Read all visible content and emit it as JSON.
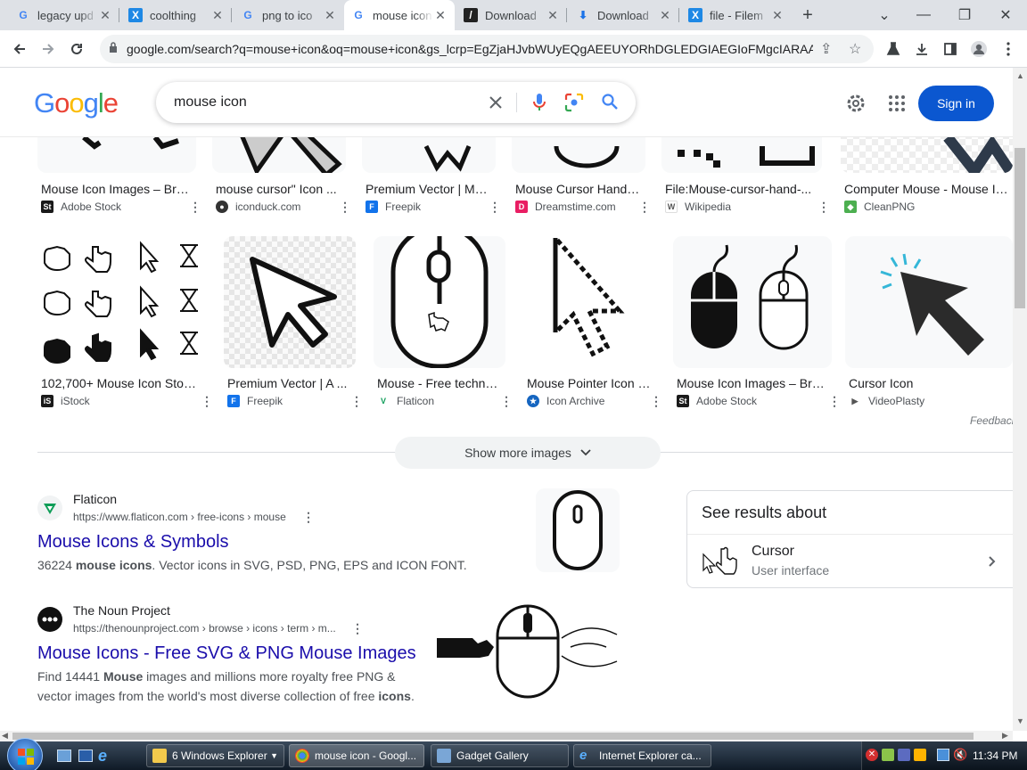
{
  "tabs": [
    {
      "title": "legacy upd",
      "fav": "G",
      "favcolor": "#4285f4"
    },
    {
      "title": "coolthing",
      "fav": "X",
      "favcolor": "#1e88e5"
    },
    {
      "title": "png to ico",
      "fav": "G",
      "favcolor": "#4285f4"
    },
    {
      "title": "mouse icon",
      "fav": "G",
      "favcolor": "#4285f4"
    },
    {
      "title": "Download",
      "fav": "/",
      "favcolor": "#333"
    },
    {
      "title": "Download",
      "fav": "⬇",
      "favcolor": "#1a73e8"
    },
    {
      "title": "file - Filem",
      "fav": "X",
      "favcolor": "#1e88e5"
    }
  ],
  "window": {
    "new_tab": "+",
    "minimize": "—",
    "maximize": "❐",
    "close": "✕",
    "tab_list": "⌄"
  },
  "omnibox": {
    "url": "google.com/search?q=mouse+icon&oq=mouse+icon&gs_lcrp=EgZjaHJvbWUyEQgAEEUYORhDGLEDGIAEGIoFMgcIARAAG..."
  },
  "search": {
    "query": "mouse icon",
    "signin": "Sign in"
  },
  "row1": [
    {
      "caption": "Mouse Icon Images – Bro...",
      "source": "Adobe Stock",
      "fav": "St",
      "favcolor": "#1a1a1a"
    },
    {
      "caption": "mouse cursor\" Icon ...",
      "source": "iconduck.com",
      "fav": "●",
      "favcolor": "#333"
    },
    {
      "caption": "Premium Vector | Mo...",
      "source": "Freepik",
      "fav": "F",
      "favcolor": "#1273eb"
    },
    {
      "caption": "Mouse Cursor Hand I...",
      "source": "Dreamstime.com",
      "fav": "D",
      "favcolor": "#e91e63"
    },
    {
      "caption": "File:Mouse-cursor-hand-...",
      "source": "Wikipedia",
      "fav": "W",
      "favcolor": "#999"
    },
    {
      "caption": "Computer Mouse - Mouse Ic...",
      "source": "CleanPNG",
      "fav": "◆",
      "favcolor": "#4caf50"
    }
  ],
  "row2": [
    {
      "caption": "102,700+ Mouse Icon Stock...",
      "source": "iStock",
      "fav": "iS",
      "favcolor": "#1a1a1a"
    },
    {
      "caption": "Premium Vector | A ...",
      "source": "Freepik",
      "fav": "F",
      "favcolor": "#1273eb"
    },
    {
      "caption": "Mouse - Free techno...",
      "source": "Flaticon",
      "fav": "V",
      "favcolor": "#0f9d58"
    },
    {
      "caption": "Mouse Pointer Icon | ...",
      "source": "Icon Archive",
      "fav": "★",
      "favcolor": "#1565c0"
    },
    {
      "caption": "Mouse Icon Images – Bro...",
      "source": "Adobe Stock",
      "fav": "St",
      "favcolor": "#1a1a1a"
    },
    {
      "caption": "Cursor Icon",
      "source": "VideoPlasty",
      "fav": "▶",
      "favcolor": "#555"
    }
  ],
  "feedback": "Feedback",
  "show_more": "Show more images",
  "results": [
    {
      "site": "Flaticon",
      "url": "https://www.flaticon.com › free-icons › mouse",
      "title": "Mouse Icons & Symbols",
      "snippet_html": "36224 <b>mouse icons</b>. Vector icons in SVG, PSD, PNG, EPS and ICON FONT."
    },
    {
      "site": "The Noun Project",
      "url": "https://thenounproject.com › browse › icons › term › m...",
      "title": "Mouse Icons - Free SVG & PNG Mouse Images",
      "snippet_html": "Find 14441 <b>Mouse</b> images and millions more royalty free PNG &amp;<br>vector images from the world's most diverse collection of free <b>icons</b>."
    }
  ],
  "knowledge": {
    "heading": "See results about",
    "item_title": "Cursor",
    "item_sub": "User interface"
  },
  "taskbar": {
    "items": [
      "6  Windows Explorer",
      "mouse icon - Googl...",
      "Gadget Gallery",
      "Internet Explorer ca..."
    ],
    "clock": "11:34 PM"
  }
}
